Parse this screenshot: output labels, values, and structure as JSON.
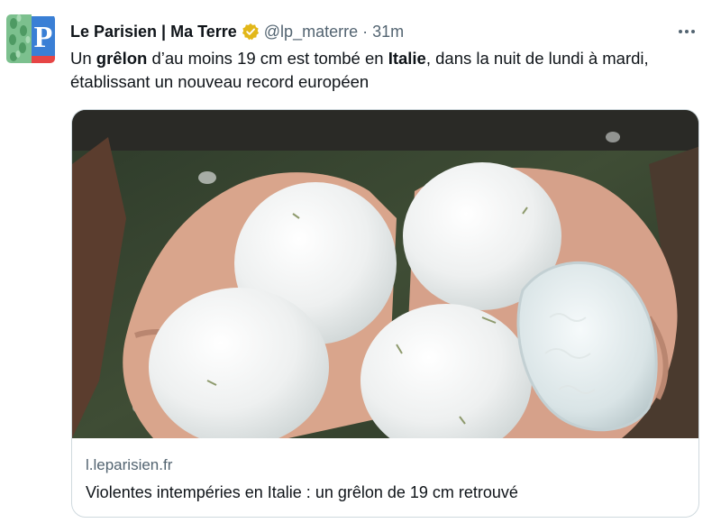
{
  "tweet": {
    "author_name": "Le Parisien | Ma Terre",
    "handle": "@lp_materre",
    "separator": "·",
    "time": "31m",
    "text_parts": {
      "p1": "Un ",
      "b1": "grêlon",
      "p2": " d’au moins 19 cm est tombé en ",
      "b2": "Italie",
      "p3": ", dans la nuit de lundi à mardi, établissant un nouveau record européen"
    },
    "avatar_letter": "P"
  },
  "card": {
    "domain": "l.leparisien.fr",
    "title": "Violentes intempéries en Italie : un grêlon de 19 cm retrouvé"
  },
  "colors": {
    "avatar_green": "#7cc08e",
    "avatar_blue": "#3a7fd5",
    "avatar_red": "#e64545",
    "verified_gold": "#e2b719",
    "secondary_text": "#536471",
    "border": "#cfd9de"
  }
}
